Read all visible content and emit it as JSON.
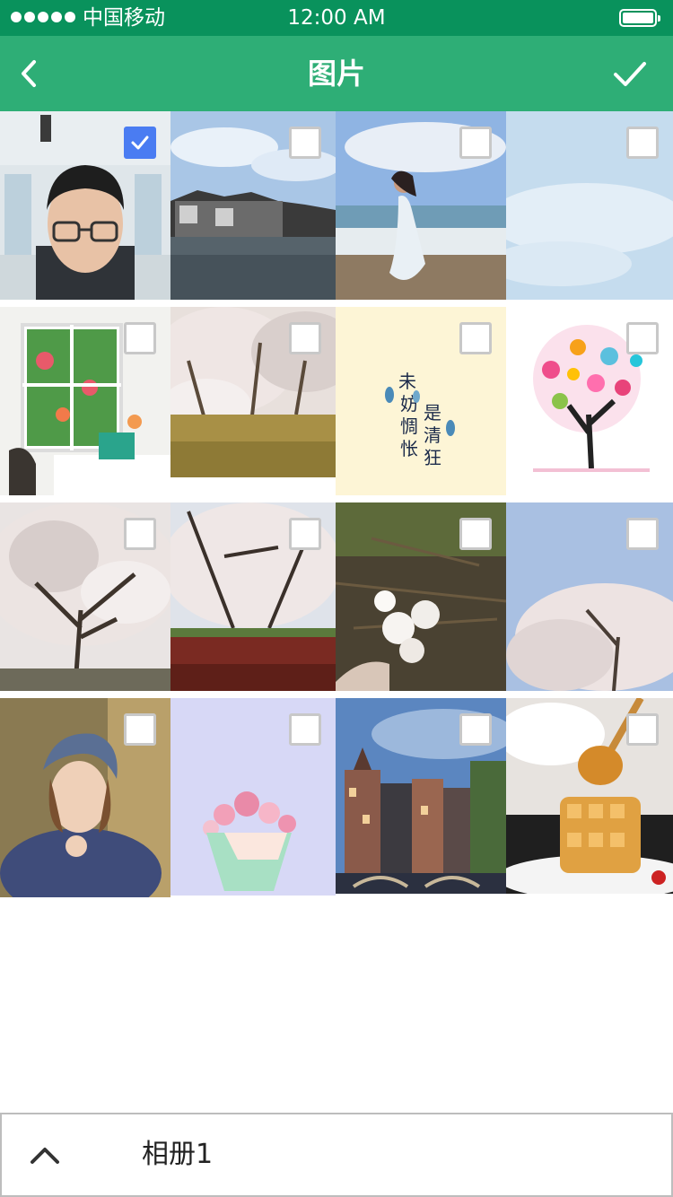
{
  "status_bar": {
    "carrier": "中国移动",
    "time": "12:00 AM"
  },
  "nav": {
    "title": "图片",
    "back_icon": "chevron-left-icon",
    "confirm_icon": "checkmark-icon"
  },
  "colors": {
    "status_bar": "#09925c",
    "nav_bar": "#2eae76",
    "checkbox_selected": "#4a7cf2"
  },
  "photos": [
    {
      "subject": "portrait of young man with glasses",
      "selected": true
    },
    {
      "subject": "canal town with old houses",
      "selected": false
    },
    {
      "subject": "woman in white dress on beach",
      "selected": false
    },
    {
      "subject": "blue sky with clouds",
      "selected": false
    },
    {
      "subject": "window with flowers and table",
      "selected": false
    },
    {
      "subject": "cherry blossom trees on lawn",
      "selected": false
    },
    {
      "subject": "calligraphy on yellow paper",
      "selected": false
    },
    {
      "subject": "colorful flower tree illustration",
      "selected": false
    },
    {
      "subject": "cherry blossom tree",
      "selected": false
    },
    {
      "subject": "cherry blossom trees and field",
      "selected": false
    },
    {
      "subject": "hand holding white flowers",
      "selected": false
    },
    {
      "subject": "cherry blossoms against sky",
      "selected": false
    },
    {
      "subject": "painting of girl with hat",
      "selected": false
    },
    {
      "subject": "pink flower bouquet on lavender",
      "selected": false
    },
    {
      "subject": "canal houses at dusk",
      "selected": false
    },
    {
      "subject": "waffles with honey dipper",
      "selected": false
    }
  ],
  "album": {
    "name": "相册1",
    "expand_icon": "chevron-up-icon"
  }
}
